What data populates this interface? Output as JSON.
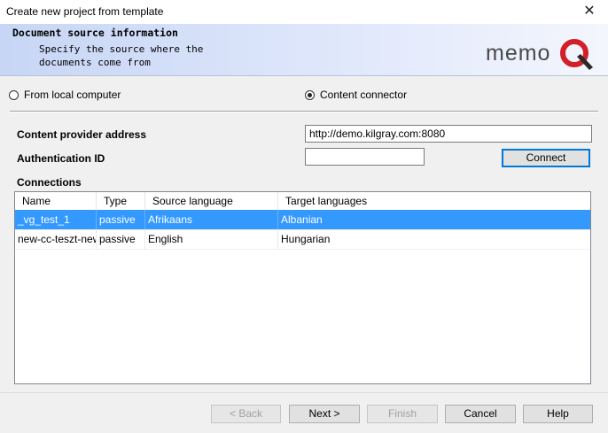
{
  "window": {
    "title": "Create new project from template",
    "close_glyph": "✕"
  },
  "header": {
    "title": "Document source information",
    "description": "Specify the source where the\ndocuments come from",
    "logo_text": "memo",
    "logo_letter": "Q"
  },
  "source": {
    "local_label": "From local computer",
    "connector_label": "Content connector",
    "selected": "connector"
  },
  "form": {
    "provider_label": "Content provider address",
    "provider_value": "http://demo.kilgray.com:8080",
    "auth_label": "Authentication ID",
    "auth_value": "",
    "connect_label": "Connect",
    "connections_label": "Connections"
  },
  "table": {
    "columns": [
      "Name",
      "Type",
      "Source language",
      "Target languages"
    ],
    "rows": [
      {
        "name": "_vg_test_1",
        "type": "passive",
        "source": "Afrikaans",
        "target": "Albanian",
        "selected": true
      },
      {
        "name": "new-cc-teszt-new",
        "type": "passive",
        "source": "English",
        "target": "Hungarian",
        "selected": false
      }
    ]
  },
  "footer": {
    "back": "< Back",
    "next": "Next >",
    "finish": "Finish",
    "cancel": "Cancel",
    "help": "Help"
  },
  "colors": {
    "selection": "#3399ff",
    "focus_border": "#0078d7",
    "logo_q": "#d21f28"
  }
}
